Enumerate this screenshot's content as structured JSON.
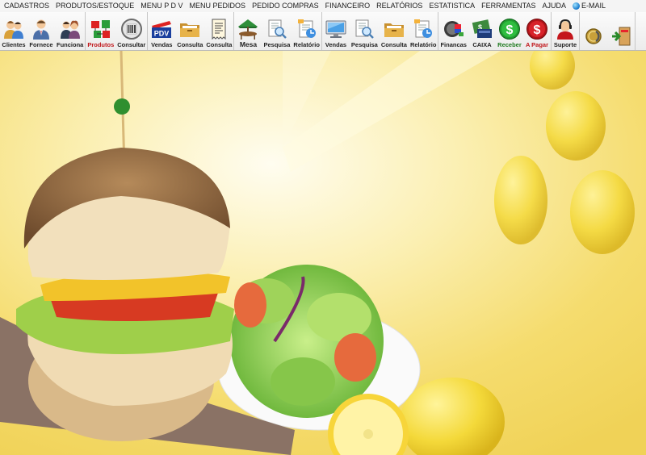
{
  "menu": [
    "CADASTROS",
    "PRODUTOS/ESTOQUE",
    "MENU P D V",
    "MENU PEDIDOS",
    "PEDIDO COMPRAS",
    "FINANCEIRO",
    "RELATÓRIOS",
    "ESTATISTICA",
    "FERRAMENTAS",
    "AJUDA"
  ],
  "menu_email": "E-MAIL",
  "toolbar": {
    "cadastros": [
      {
        "label": "Clientes",
        "icon": "clients-icon"
      },
      {
        "label": "Fornece",
        "icon": "supplier-icon"
      },
      {
        "label": "Funciona",
        "icon": "employee-icon"
      }
    ],
    "produtos": [
      {
        "label": "Produtos",
        "icon": "products-icon"
      },
      {
        "label": "Consultar",
        "icon": "barcode-icon"
      }
    ],
    "pdv": [
      {
        "label": "Vendas",
        "icon": "pdv-icon",
        "badge": "PDV"
      },
      {
        "label": "Consulta",
        "icon": "folder-icon"
      },
      {
        "label": "Consulta",
        "icon": "receipt-icon"
      }
    ],
    "pedidos": [
      {
        "label": "Mesa",
        "icon": "table-icon"
      },
      {
        "label": "Pesquisa",
        "icon": "search-doc-icon"
      },
      {
        "label": "Relatório",
        "icon": "report-icon"
      }
    ],
    "pedido_compras": [
      {
        "label": "Vendas",
        "icon": "monitor-icon"
      },
      {
        "label": "Pesquisa",
        "icon": "search-doc-icon"
      },
      {
        "label": "Consulta",
        "icon": "folder-icon"
      },
      {
        "label": "Relatório",
        "icon": "report-icon"
      }
    ],
    "financeiro": [
      {
        "label": "Financas",
        "icon": "finance-icon"
      },
      {
        "label": "CAIXA",
        "icon": "cash-register-icon"
      },
      {
        "label": "Receber",
        "icon": "receive-money-icon"
      },
      {
        "label": "A Pagar",
        "icon": "pay-money-icon"
      }
    ],
    "suporte": [
      {
        "label": "Suporte",
        "icon": "support-icon"
      }
    ],
    "ferramentas": [
      {
        "label": "",
        "icon": "coin-icon"
      },
      {
        "label": "",
        "icon": "exit-icon"
      }
    ]
  },
  "colors": {
    "menubar_bg": "#f4f4f4",
    "toolbar_bg": "#efefef",
    "label_red": "#c0161a",
    "label_green": "#1e7a1e",
    "background_yellow": "#f7e27a"
  }
}
